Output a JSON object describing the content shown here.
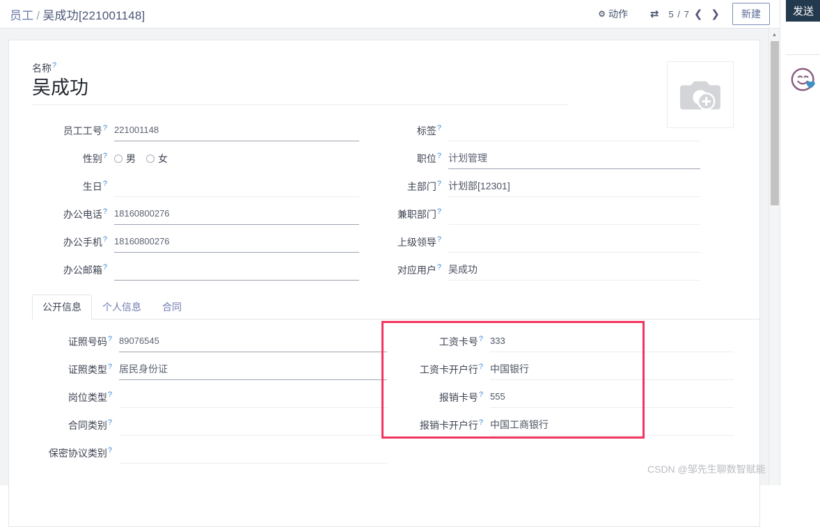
{
  "topbar": {
    "breadcrumb_root": "员工",
    "breadcrumb_sep": "/",
    "breadcrumb_current": "吴成功[221001148]",
    "action_label": "动作",
    "gear_icon": "gear-icon",
    "refresh_icon": "refresh-icon",
    "pager": "5 / 7",
    "prev_icon": "❮",
    "next_icon": "❯",
    "new_label": "新建"
  },
  "right_panel": {
    "send_label": "发送",
    "avatar_icon": "smiley-face-icon"
  },
  "scrollbar": {
    "up_arrow": "▲"
  },
  "name": {
    "label": "名称",
    "value": "吴成功"
  },
  "photo": {
    "icon": "camera-add-photo-icon"
  },
  "form_left": [
    {
      "label": "员工工号",
      "value": "221001148",
      "filled": true,
      "type": "text"
    },
    {
      "label": "性别",
      "value": "",
      "filled": false,
      "type": "radio",
      "options": [
        "男",
        "女"
      ]
    },
    {
      "label": "生日",
      "value": "",
      "filled": false,
      "type": "text"
    },
    {
      "label": "办公电话",
      "value": "18160800276",
      "filled": true,
      "type": "text"
    },
    {
      "label": "办公手机",
      "value": "18160800276",
      "filled": true,
      "type": "text"
    },
    {
      "label": "办公邮箱",
      "value": "",
      "filled": true,
      "type": "text"
    }
  ],
  "form_right": [
    {
      "label": "标签",
      "value": "",
      "filled": false,
      "type": "text"
    },
    {
      "label": "职位",
      "value": "计划管理",
      "filled": true,
      "type": "cjk"
    },
    {
      "label": "主部门",
      "value": "计划部[12301]",
      "filled": false,
      "type": "cjk"
    },
    {
      "label": "兼职部门",
      "value": "",
      "filled": false,
      "type": "text"
    },
    {
      "label": "上级领导",
      "value": "",
      "filled": false,
      "type": "text"
    },
    {
      "label": "对应用户",
      "value": "吴成功",
      "filled": false,
      "type": "cjk"
    }
  ],
  "tabs": [
    {
      "label": "公开信息",
      "active": true
    },
    {
      "label": "个人信息",
      "active": false
    },
    {
      "label": "合同",
      "active": false
    }
  ],
  "tab_left": [
    {
      "label": "证照号码",
      "value": "89076545",
      "filled": true,
      "type": "text"
    },
    {
      "label": "证照类型",
      "value": "居民身份证",
      "filled": true,
      "type": "cjk"
    },
    {
      "label": "岗位类型",
      "value": "",
      "filled": false,
      "type": "text"
    },
    {
      "label": "合同类别",
      "value": "",
      "filled": false,
      "type": "text"
    },
    {
      "label": "保密协议类别",
      "value": "",
      "filled": false,
      "type": "text"
    }
  ],
  "tab_right": [
    {
      "label": "工资卡号",
      "value": "333",
      "filled": false,
      "type": "text"
    },
    {
      "label": "工资卡开户行",
      "value": "中国银行",
      "filled": false,
      "type": "cjk"
    },
    {
      "label": "报销卡号",
      "value": "555",
      "filled": false,
      "type": "text"
    },
    {
      "label": "报销卡开户行",
      "value": "中国工商银行",
      "filled": false,
      "type": "cjk"
    }
  ],
  "bottom_cut": {
    "left_label": "",
    "right_label": ""
  },
  "watermark": "CSDN @邹先生聊数智赋能",
  "colors": {
    "accent_blue": "#3b8ad9",
    "link_purple": "#6f7bb0",
    "highlight_red": "#f2325f",
    "send_dark": "#23394d",
    "page_bg": "#f2f3f5"
  }
}
